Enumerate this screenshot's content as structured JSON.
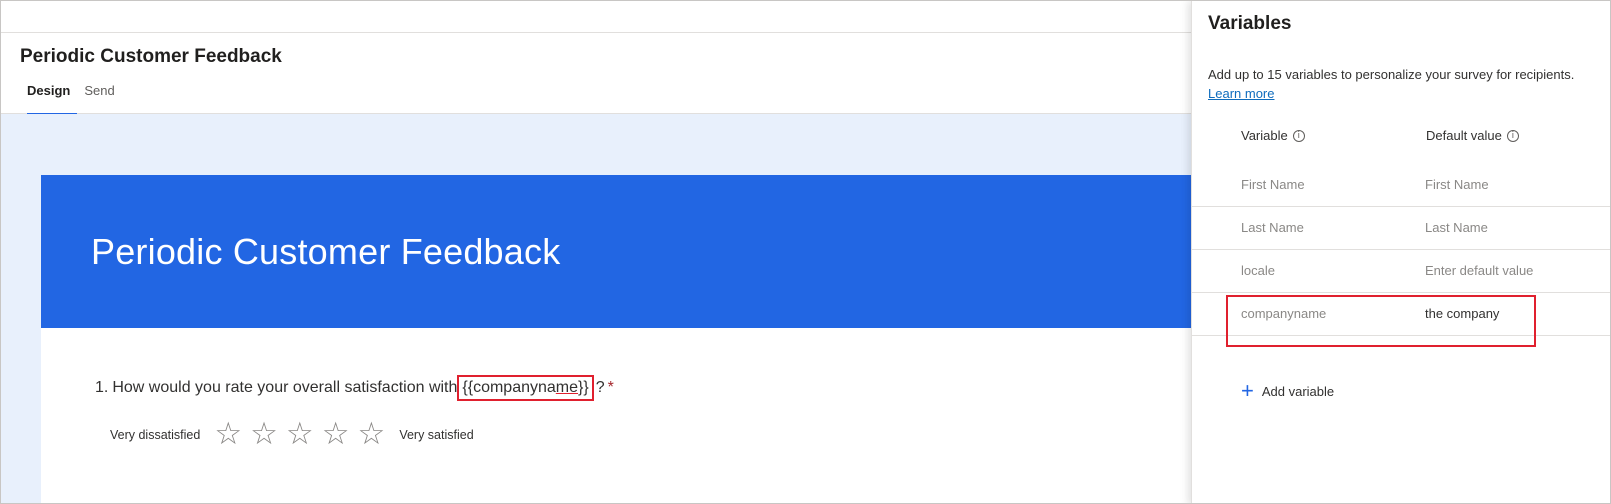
{
  "header": {
    "title": "Periodic Customer Feedback",
    "tabs": [
      {
        "label": "Design",
        "active": true
      },
      {
        "label": "Send",
        "active": false
      }
    ]
  },
  "survey": {
    "banner_title": "Periodic Customer Feedback",
    "banner_color": "#2266e3",
    "question": {
      "number": "1.",
      "text_before": "How would you rate your overall satisfaction with",
      "token_part1": "{{companyna",
      "token_part2": "me",
      "token_part3": "}}",
      "text_after": "?",
      "required_mark": "*"
    },
    "rating": {
      "low_label": "Very dissatisfied",
      "high_label": "Very satisfied",
      "star_count": 5,
      "star_glyph": "☆"
    }
  },
  "panel": {
    "title": "Variables",
    "description": "Add up to 15 variables to personalize your survey for recipients.",
    "learn_more": "Learn more",
    "col_variable": "Variable",
    "col_default": "Default value",
    "info_glyph": "i",
    "rows": [
      {
        "name": "First Name",
        "default": "First Name",
        "filled": false
      },
      {
        "name": "Last Name",
        "default": "Last Name",
        "filled": false
      },
      {
        "name": "locale",
        "default": "Enter default value",
        "filled": false
      },
      {
        "name": "companyname",
        "default": "the company",
        "filled": true
      }
    ],
    "add_variable": "Add variable",
    "plus_glyph": "+"
  },
  "colors": {
    "accent": "#2266e3",
    "highlight": "#e0202e",
    "canvas_bg": "#e8f0fc"
  }
}
